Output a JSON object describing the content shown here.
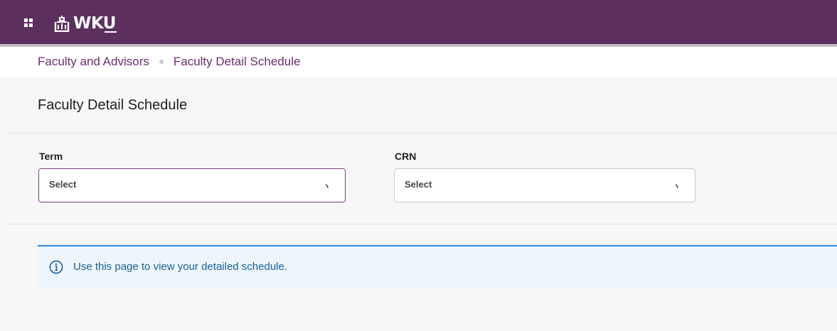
{
  "header": {
    "brand": "WKU",
    "brand_color": "#5c2f5e",
    "apps_icon": "apps-grid-icon",
    "logo_icon": "wku-cupola-icon"
  },
  "breadcrumb": {
    "items": [
      "Faculty and Advisors",
      "Faculty Detail Schedule"
    ]
  },
  "page": {
    "title": "Faculty Detail Schedule"
  },
  "form": {
    "term": {
      "label": "Term",
      "value": "Select"
    },
    "crn": {
      "label": "CRN",
      "value": "Select"
    }
  },
  "info": {
    "icon": "info-circle-icon",
    "message": "Use this page to view your detailed schedule.",
    "accent_color": "#2a8bd2"
  }
}
